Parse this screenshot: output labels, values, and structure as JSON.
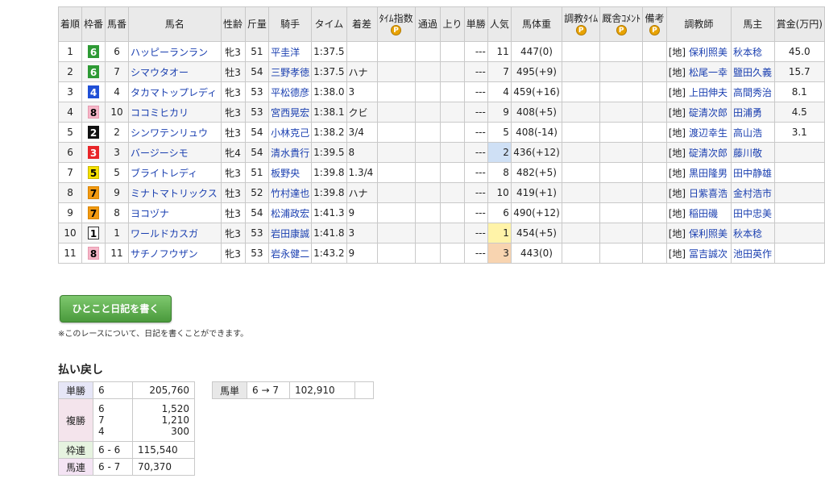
{
  "headers": {
    "rank": "着順",
    "frame": "枠番",
    "horse_no": "馬番",
    "horse_name": "馬名",
    "sex_age": "性齢",
    "weight": "斤量",
    "jockey": "騎手",
    "time": "タイム",
    "margin": "着差",
    "time_index": "ﾀｲﾑ指数",
    "passing": "通過",
    "last3f": "上り",
    "odds": "単勝",
    "popularity": "人気",
    "body_weight": "馬体重",
    "training_time": "調教ﾀｲﾑ",
    "stable_comment": "厩舎ｺﾒﾝﾄ",
    "remarks": "備考",
    "trainer": "調教師",
    "owner": "馬主",
    "prize": "賞金(万円)",
    "premium_badge": "P"
  },
  "rows": [
    {
      "rank": "1",
      "frame": "6",
      "horse_no": "6",
      "name": "ハッピーランラン",
      "sex_age": "牝3",
      "weight": "51",
      "jockey": "平圭洋",
      "time": "1:37.5",
      "margin": "",
      "odds": "---",
      "pop": "11",
      "body": "447(0)",
      "region": "[地]",
      "trainer": "保利照美",
      "owner": "秋本稔",
      "prize": "45.0"
    },
    {
      "rank": "2",
      "frame": "6",
      "horse_no": "7",
      "name": "シマウタオー",
      "sex_age": "牡3",
      "weight": "54",
      "jockey": "三野孝徳",
      "time": "1:37.5",
      "margin": "ハナ",
      "odds": "---",
      "pop": "7",
      "body": "495(+9)",
      "region": "[地]",
      "trainer": "松尾一幸",
      "owner": "鹽田久義",
      "prize": "15.7"
    },
    {
      "rank": "3",
      "frame": "4",
      "horse_no": "4",
      "name": "タカマトップレディ",
      "sex_age": "牝3",
      "weight": "53",
      "jockey": "平松德彦",
      "time": "1:38.0",
      "margin": "3",
      "odds": "---",
      "pop": "4",
      "body": "459(+16)",
      "region": "[地]",
      "trainer": "上田伸夫",
      "owner": "高間秀治",
      "prize": "8.1"
    },
    {
      "rank": "4",
      "frame": "8",
      "horse_no": "10",
      "name": "ココミヒカリ",
      "sex_age": "牝3",
      "weight": "53",
      "jockey": "宮西晃宏",
      "time": "1:38.1",
      "margin": "クビ",
      "odds": "---",
      "pop": "9",
      "body": "408(+5)",
      "region": "[地]",
      "trainer": "碇清次郎",
      "owner": "田浦勇",
      "prize": "4.5"
    },
    {
      "rank": "5",
      "frame": "2",
      "horse_no": "2",
      "name": "シンワテンリュウ",
      "sex_age": "牡3",
      "weight": "54",
      "jockey": "小林克己",
      "time": "1:38.2",
      "margin": "3/4",
      "odds": "---",
      "pop": "5",
      "body": "408(-14)",
      "region": "[地]",
      "trainer": "渡辺幸生",
      "owner": "高山浩",
      "prize": "3.1"
    },
    {
      "rank": "6",
      "frame": "3",
      "horse_no": "3",
      "name": "バージーシモ",
      "sex_age": "牝4",
      "weight": "54",
      "jockey": "清水貴行",
      "time": "1:39.5",
      "margin": "8",
      "odds": "---",
      "pop": "2",
      "body": "436(+12)",
      "region": "[地]",
      "trainer": "碇清次郎",
      "owner": "藤川敬",
      "prize": ""
    },
    {
      "rank": "7",
      "frame": "5",
      "horse_no": "5",
      "name": "ブライトレディ",
      "sex_age": "牝3",
      "weight": "51",
      "jockey": "板野央",
      "time": "1:39.8",
      "margin": "1.3/4",
      "odds": "---",
      "pop": "8",
      "body": "482(+5)",
      "region": "[地]",
      "trainer": "黒田隆男",
      "owner": "田中静雄",
      "prize": ""
    },
    {
      "rank": "8",
      "frame": "7",
      "horse_no": "9",
      "name": "ミナトマトリックス",
      "sex_age": "牡3",
      "weight": "52",
      "jockey": "竹村達也",
      "time": "1:39.8",
      "margin": "ハナ",
      "odds": "---",
      "pop": "10",
      "body": "419(+1)",
      "region": "[地]",
      "trainer": "日紫喜浩",
      "owner": "金村浩市",
      "prize": ""
    },
    {
      "rank": "9",
      "frame": "7",
      "horse_no": "8",
      "name": "ヨコヅナ",
      "sex_age": "牡3",
      "weight": "54",
      "jockey": "松浦政宏",
      "time": "1:41.3",
      "margin": "9",
      "odds": "---",
      "pop": "6",
      "body": "490(+12)",
      "region": "[地]",
      "trainer": "稲田磯",
      "owner": "田中忠美",
      "prize": ""
    },
    {
      "rank": "10",
      "frame": "1",
      "horse_no": "1",
      "name": "ワールドカスガ",
      "sex_age": "牝3",
      "weight": "53",
      "jockey": "岩田康誠",
      "time": "1:41.8",
      "margin": "3",
      "odds": "---",
      "pop": "1",
      "body": "454(+5)",
      "region": "[地]",
      "trainer": "保利照美",
      "owner": "秋本稔",
      "prize": ""
    },
    {
      "rank": "11",
      "frame": "8",
      "horse_no": "11",
      "name": "サチノフウザン",
      "sex_age": "牝3",
      "weight": "53",
      "jockey": "岩永健二",
      "time": "1:43.2",
      "margin": "9",
      "odds": "---",
      "pop": "3",
      "body": "443(0)",
      "region": "[地]",
      "trainer": "冨吉誠次",
      "owner": "池田英作",
      "prize": ""
    }
  ],
  "frame_colors": {
    "1": {
      "bg": "#ffffff",
      "fg": "#000000",
      "border": "#333333"
    },
    "2": {
      "bg": "#111111",
      "fg": "#ffffff",
      "border": "#111111"
    },
    "3": {
      "bg": "#e8262a",
      "fg": "#ffffff",
      "border": "#e8262a"
    },
    "4": {
      "bg": "#1f4fd6",
      "fg": "#ffffff",
      "border": "#1f4fd6"
    },
    "5": {
      "bg": "#f5e000",
      "fg": "#000000",
      "border": "#c9b800"
    },
    "6": {
      "bg": "#2e9a35",
      "fg": "#ffffff",
      "border": "#2e9a35"
    },
    "7": {
      "bg": "#f29a12",
      "fg": "#000000",
      "border": "#d98500"
    },
    "8": {
      "bg": "#f6b6c8",
      "fg": "#000000",
      "border": "#e89ab0"
    }
  },
  "diary": {
    "button_label": "ひとこと日記を書く",
    "note": "※このレースについて、日記を書くことができます。"
  },
  "payout": {
    "title": "払い戻し",
    "tansho": {
      "label": "単勝",
      "num": "6",
      "pay": "205,760"
    },
    "fukusho": {
      "label": "複勝",
      "nums": [
        "6",
        "7",
        "4"
      ],
      "pays": [
        "1,520",
        "1,210",
        "300"
      ]
    },
    "wakuren": {
      "label": "枠連",
      "num": "6 - 6",
      "pay": "115,540"
    },
    "umaren": {
      "label": "馬連",
      "num": "6 - 7",
      "pay": "70,370"
    },
    "umatan": {
      "label": "馬単",
      "num": "6 → 7",
      "pay": "102,910"
    }
  }
}
